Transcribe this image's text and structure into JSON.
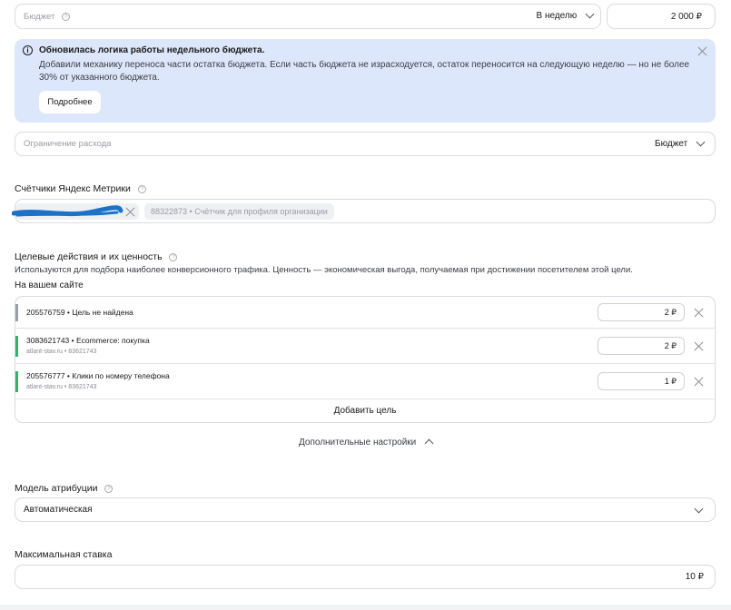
{
  "budget": {
    "placeholder": "Бюджет",
    "period": "В неделю",
    "amount": "2 000 ₽"
  },
  "notice": {
    "title": "Обновилась логика работы недельного бюджета.",
    "text": "Добавили механику переноса части остатка бюджета. Если часть бюджета не израсходуется, остаток переносится на следующую неделю — но не более 30% от указанного бюджета.",
    "button": "Подробнее",
    "bg_color": "#dde7fb"
  },
  "spend_limit": {
    "placeholder": "Ограничение расхода",
    "value": "Бюджет"
  },
  "counters": {
    "label": "Счётчики Яндекс Метрики",
    "secondary_chip": "88322873 • Счётчик для профиля организации"
  },
  "goals": {
    "label": "Целевые действия и их ценность",
    "description": "Используются для подбора наиболее конверсионного трафика. Ценность — экономическая выгода, получаемая при достижении посетителем этой цели.",
    "section": "На вашем сайте",
    "items": [
      {
        "title": "205576759 • Цель не найдена",
        "subtitle": "",
        "value": "2 ₽",
        "color": "#9aa0ab"
      },
      {
        "title": "3083621743 • Ecommerce: покупка",
        "subtitle": "atlant-stav.ru • 83621743",
        "value": "2 ₽",
        "color": "#2fb56b"
      },
      {
        "title": "205576777 • Клики по номеру телефона",
        "subtitle": "atlant-stav.ru • 83621743",
        "value": "1 ₽",
        "color": "#2fb56b"
      }
    ],
    "add_button": "Добавить цель"
  },
  "advanced": {
    "label": "Дополнительные настройки"
  },
  "attribution": {
    "label": "Модель атрибуции",
    "value": "Автоматическая"
  },
  "max_bid": {
    "label": "Максимальная ставка",
    "value": "10 ₽"
  },
  "colors": {
    "accent_scribble": "#1a73c8",
    "border": "#d9dbe0"
  }
}
